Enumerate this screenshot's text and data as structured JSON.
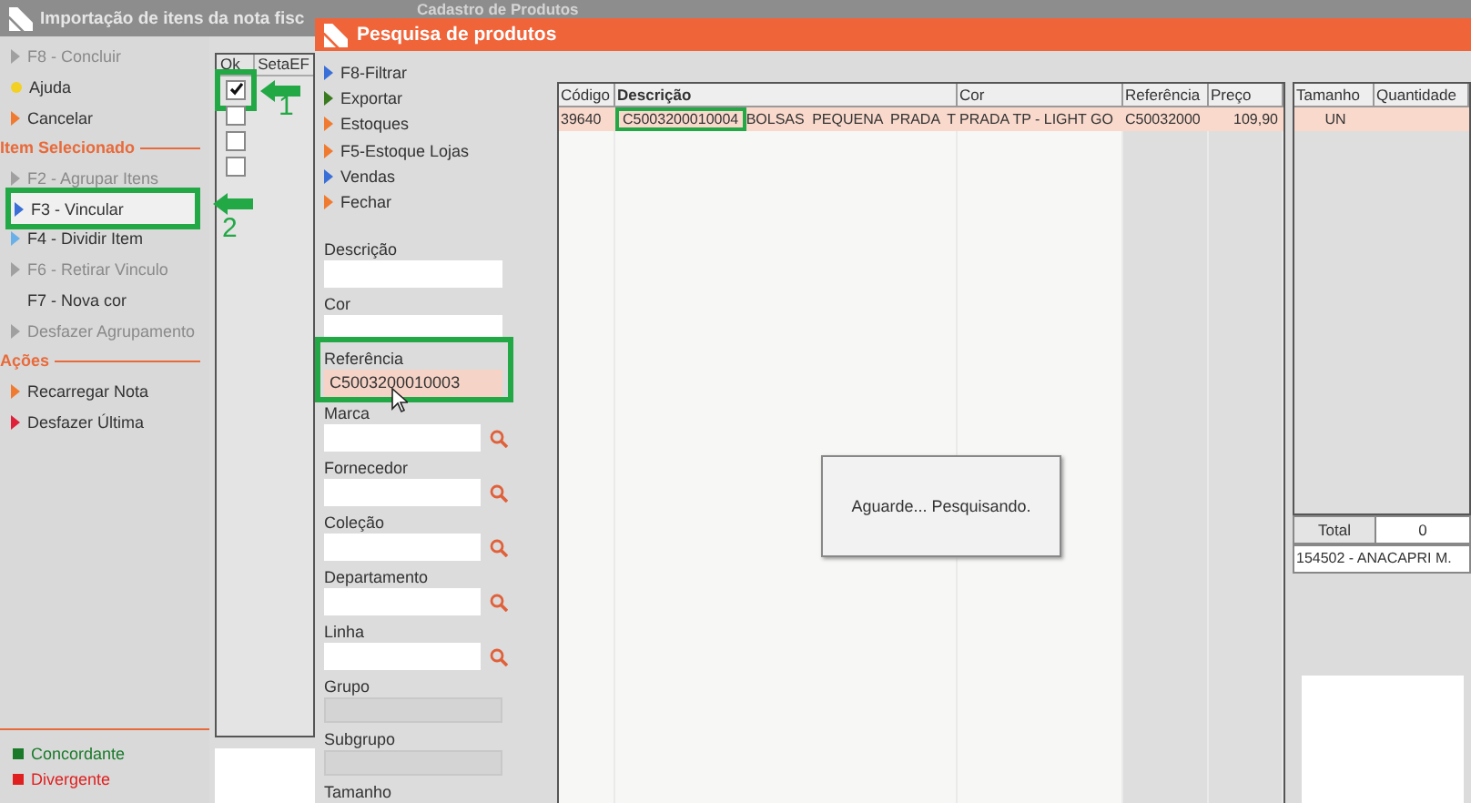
{
  "background_window": {
    "title": "Cadastro de Produtos"
  },
  "import_window": {
    "title": "Importação de itens da nota fisc",
    "menu": [
      {
        "kind": "item",
        "label": "F8 - Concluir",
        "color": "#a0a0a0",
        "disabled": true,
        "selected": false
      },
      {
        "kind": "dot",
        "label": "Ajuda",
        "color": "#f2d024",
        "disabled": false,
        "selected": false
      },
      {
        "kind": "item",
        "label": "Cancelar",
        "color": "#f07a30",
        "disabled": false,
        "selected": false
      },
      {
        "kind": "header",
        "label": "Item Selecionado"
      },
      {
        "kind": "item",
        "label": "F2 - Agrupar Itens",
        "color": "#a0a0a0",
        "disabled": true,
        "selected": false
      },
      {
        "kind": "item",
        "label": "F3 - Vincular",
        "color": "#3a6fd8",
        "disabled": false,
        "selected": true
      },
      {
        "kind": "item",
        "label": "F4 - Dividir Item",
        "color": "#6ab0e8",
        "disabled": false,
        "selected": false
      },
      {
        "kind": "item",
        "label": "F6 - Retirar Vinculo",
        "color": "#a0a0a0",
        "disabled": true,
        "selected": false
      },
      {
        "kind": "plain",
        "label": "F7 - Nova cor",
        "disabled": false,
        "selected": false
      },
      {
        "kind": "item",
        "label": "Desfazer Agrupamento",
        "color": "#a0a0a0",
        "disabled": true,
        "selected": false
      },
      {
        "kind": "header",
        "label": "Ações"
      },
      {
        "kind": "item",
        "label": "Recarregar Nota",
        "color": "#f07a30",
        "disabled": false,
        "selected": false
      },
      {
        "kind": "item",
        "label": "Desfazer Última",
        "color": "#e0203a",
        "disabled": false,
        "selected": false
      }
    ],
    "grid": {
      "columns": [
        "Ok",
        "SetaEF"
      ],
      "rows": [
        {
          "checked": true
        },
        {
          "checked": false
        },
        {
          "checked": false
        },
        {
          "checked": false
        }
      ]
    },
    "legend": [
      {
        "label": "Concordante",
        "color": "#1a7a2a"
      },
      {
        "label": "Divergente",
        "color": "#e02020"
      }
    ]
  },
  "search_window": {
    "title": "Pesquisa de produtos",
    "actions": [
      {
        "label": "F8-Filtrar",
        "color": "#3a6fd8"
      },
      {
        "label": "Exportar",
        "color": "#3a7a20"
      },
      {
        "label": "Estoques",
        "color": "#f07a30"
      },
      {
        "label": "F5-Estoque Lojas",
        "color": "#f07a30"
      },
      {
        "label": "Vendas",
        "color": "#3a6fd8"
      },
      {
        "label": "Fechar",
        "color": "#f07a30"
      }
    ],
    "filters": [
      {
        "kind": "text",
        "label": "Descrição"
      },
      {
        "kind": "text",
        "label": "Cor"
      },
      {
        "kind": "text",
        "label": "Referência",
        "value": "C5003200010003"
      },
      {
        "kind": "lookup",
        "label": "Marca"
      },
      {
        "kind": "lookup",
        "label": "Fornecedor"
      },
      {
        "kind": "lookup",
        "label": "Coleção"
      },
      {
        "kind": "lookup",
        "label": "Departamento"
      },
      {
        "kind": "lookup",
        "label": "Linha"
      },
      {
        "kind": "disabled",
        "label": "Grupo"
      },
      {
        "kind": "disabled",
        "label": "Subgrupo"
      },
      {
        "kind": "label",
        "label": "Tamanho"
      }
    ],
    "results": {
      "columns": [
        "Código",
        "Descrição",
        "Cor",
        "Referência",
        "Preço"
      ],
      "rows": [
        {
          "selected": true,
          "cells": [
            "39640",
            "C5003200010004 BOLSAS PEQUENA PRADA T",
            "PRADA TP - LIGHT GO",
            "C50032000",
            "109,90"
          ]
        }
      ]
    },
    "sizes": {
      "columns": [
        "Tamanho",
        "Quantidade"
      ],
      "rows": [
        {
          "selected": true,
          "cells": [
            "UN",
            ""
          ]
        }
      ],
      "total_label": "Total",
      "total_value": "0",
      "store": "154502 - ANACAPRI M."
    },
    "dialog": {
      "message": "Aguarde... Pesquisando."
    }
  },
  "annotations": [
    {
      "kind": "arrow",
      "label": "1"
    },
    {
      "kind": "arrow",
      "label": "2"
    }
  ]
}
